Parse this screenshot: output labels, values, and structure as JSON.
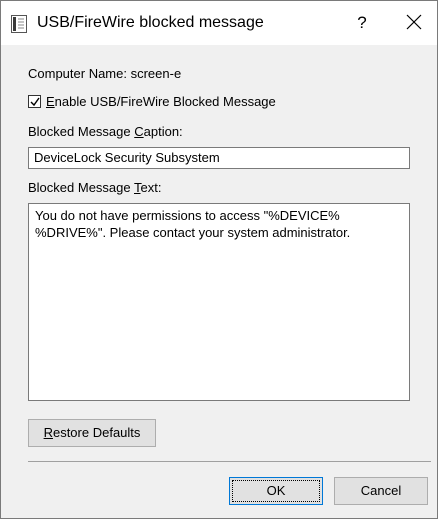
{
  "window": {
    "title": "USB/FireWire blocked message",
    "help_label": "?",
    "close_icon": "close-icon"
  },
  "computer_name_label": "Computer Name: screen-e",
  "enable_checkbox": {
    "checked": true,
    "label_mnemonic": "E",
    "label_rest": "nable USB/FireWire Blocked Message"
  },
  "caption": {
    "label_before": "Blocked Message ",
    "label_mnemonic": "C",
    "label_after": "aption:",
    "value": "DeviceLock Security Subsystem"
  },
  "message_text": {
    "label_before": "Blocked Message ",
    "label_mnemonic": "T",
    "label_after": "ext:",
    "value": "You do not have permissions to access \"%DEVICE%\n%DRIVE%\". Please contact your system administrator."
  },
  "buttons": {
    "restore_mnemonic": "R",
    "restore_rest": "estore Defaults",
    "ok": "OK",
    "cancel": "Cancel"
  },
  "colors": {
    "dialog_bg": "#f0f0f0",
    "focus_border": "#0078d7",
    "button_bg": "#e1e1e1"
  }
}
